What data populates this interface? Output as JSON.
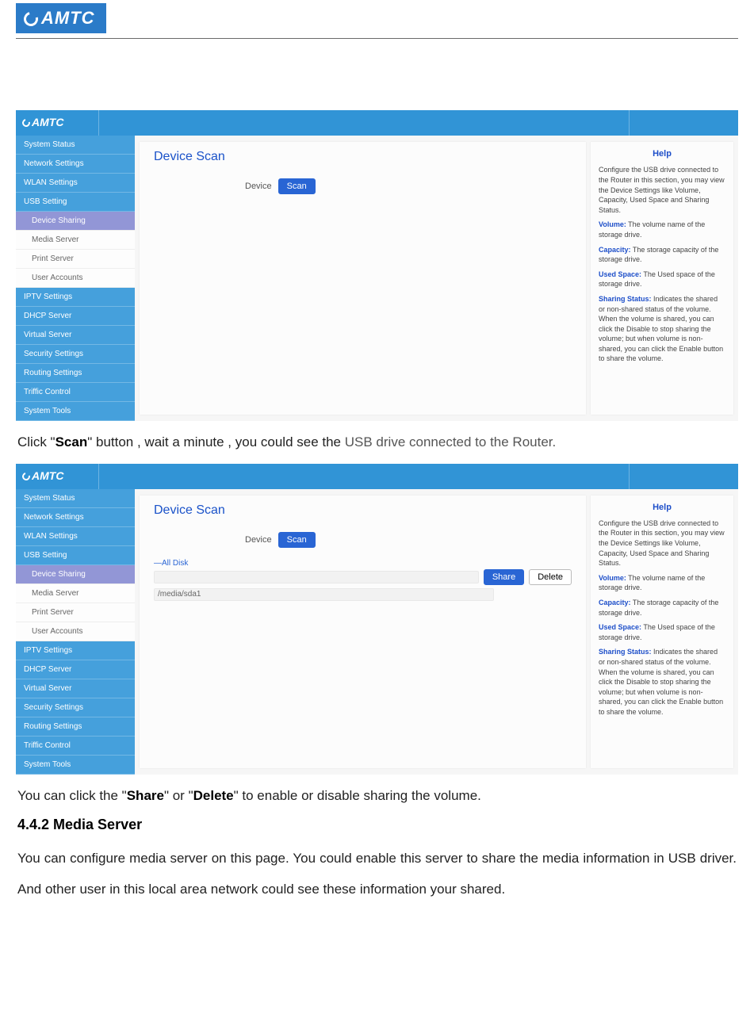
{
  "brand": "AMTC",
  "screenshot": {
    "logo": "AMTC",
    "sidebar": {
      "items": [
        {
          "label": "System Status",
          "type": "main"
        },
        {
          "label": "Network Settings",
          "type": "main"
        },
        {
          "label": "WLAN Settings",
          "type": "main"
        },
        {
          "label": "USB Setting",
          "type": "main"
        },
        {
          "label": "Device Sharing",
          "type": "sub",
          "active": true
        },
        {
          "label": "Media Server",
          "type": "sub"
        },
        {
          "label": "Print Server",
          "type": "sub"
        },
        {
          "label": "User Accounts",
          "type": "sub"
        },
        {
          "label": "IPTV Settings",
          "type": "main"
        },
        {
          "label": "DHCP Server",
          "type": "main"
        },
        {
          "label": "Virtual Server",
          "type": "main"
        },
        {
          "label": "Security Settings",
          "type": "main"
        },
        {
          "label": "Routing Settings",
          "type": "main"
        },
        {
          "label": "Triffic Control",
          "type": "main"
        },
        {
          "label": "System Tools",
          "type": "main"
        }
      ]
    },
    "main": {
      "title": "Device Scan",
      "device_label": "Device",
      "scan_button": "Scan",
      "disk": {
        "all_label": "All Disk",
        "share_button": "Share",
        "delete_button": "Delete",
        "path": "/media/sda1"
      }
    },
    "help": {
      "title": "Help",
      "intro": "Configure the USB drive connected to the Router in this section, you may view the Device Settings like Volume, Capacity, Used Space and Sharing Status.",
      "terms": [
        {
          "name": "Volume:",
          "desc": " The volume name of the storage drive."
        },
        {
          "name": "Capacity:",
          "desc": " The storage capacity of the storage drive."
        },
        {
          "name": "Used Space:",
          "desc": " The Used space of the storage drive."
        },
        {
          "name": "Sharing Status:",
          "desc": " Indicates the shared or non-shared status of the volume. When the volume is shared, you can click the Disable to stop sharing the volume; but when volume is non-shared, you can click the Enable button to share the volume."
        }
      ]
    }
  },
  "text": {
    "p1_pre": "Click \"",
    "p1_bold": "Scan",
    "p1_post": "\" button , wait a minute , you could see the ",
    "p1_gray": "USB drive connected to the Router.",
    "p2_a": "You can click the \"",
    "p2_bold1": "Share",
    "p2_b": "\" or \"",
    "p2_bold2": "Delete",
    "p2_c": "\" to enable or disable sharing the volume.",
    "section": "4.4.2 Media Server",
    "p3": "You can configure media server on this page. You could enable this server to share the media information in USB driver. And other user in this local area network could see these information your shared."
  }
}
